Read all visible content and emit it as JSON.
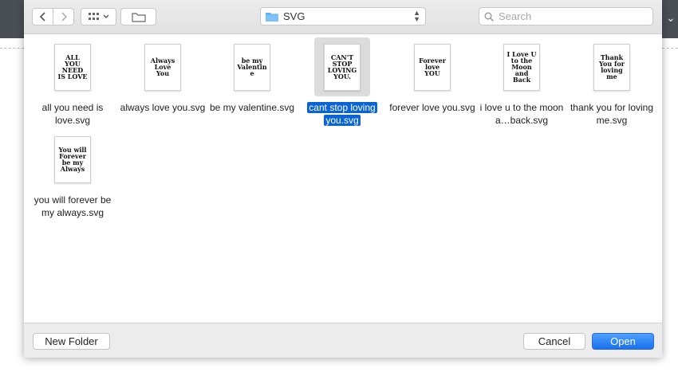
{
  "toolbar": {
    "back_icon": "chevron-left-icon",
    "forward_icon": "chevron-right-icon",
    "location": "SVG",
    "search_placeholder": "Search"
  },
  "files": [
    {
      "name": "all you need is love.svg",
      "art": "ALL YOU NEED IS LOVE",
      "selected": false
    },
    {
      "name": "always love you.svg",
      "art": "Always Love You",
      "selected": false
    },
    {
      "name": "be my valentine.svg",
      "art": "be my Valentine",
      "selected": false
    },
    {
      "name": "cant stop loving you.svg",
      "art": "CAN'T STOP LOVING YOU.",
      "selected": true
    },
    {
      "name": "forever love you.svg",
      "art": "Forever love YOU",
      "selected": false
    },
    {
      "name": "i love u to the moon a…back.svg",
      "art": "I Love U to the Moon and Back",
      "selected": false
    },
    {
      "name": "thank you for loving me.svg",
      "art": "Thank You for loving me",
      "selected": false
    },
    {
      "name": "you will forever be my always.svg",
      "art": "You will Forever be my Always",
      "selected": false
    }
  ],
  "footer": {
    "new_folder": "New Folder",
    "cancel": "Cancel",
    "open": "Open"
  },
  "colors": {
    "selection": "#0a64d6",
    "primary_button": "#1a6ff0"
  }
}
